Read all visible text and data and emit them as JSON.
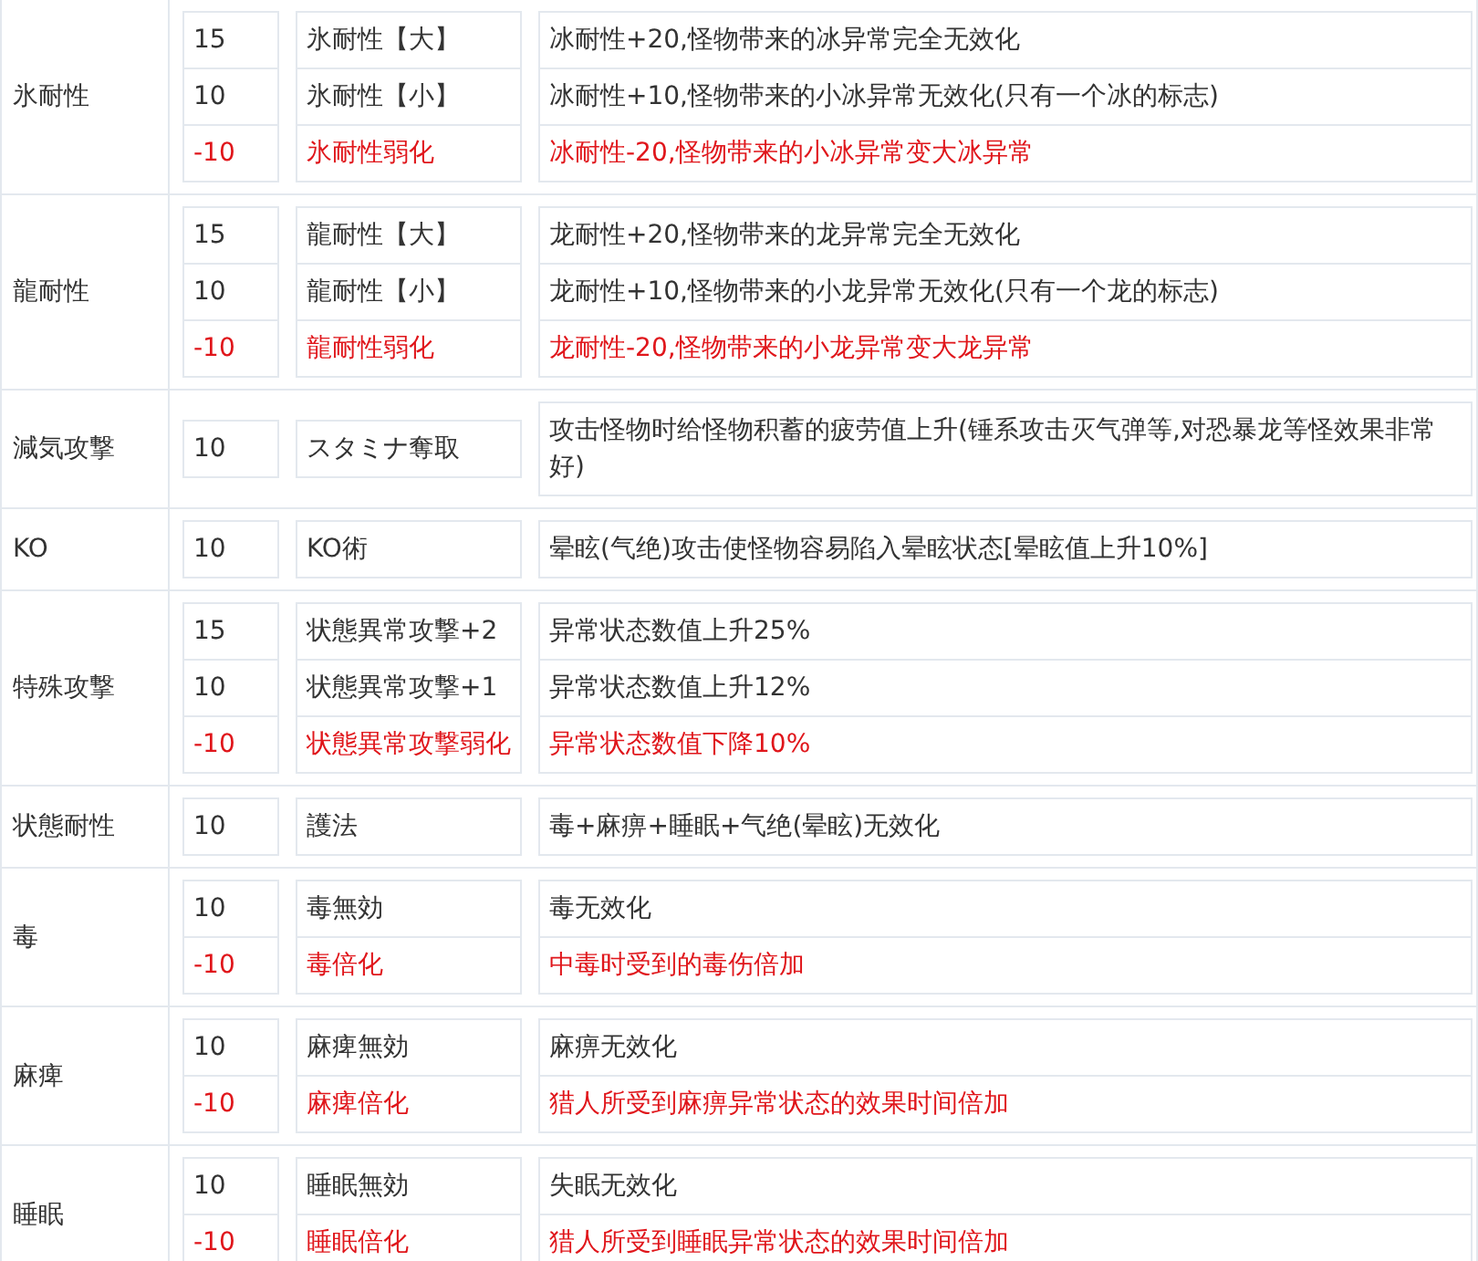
{
  "groups": [
    {
      "name": "氷耐性",
      "effects": [
        {
          "points": "15",
          "skill": "氷耐性【大】",
          "description": "冰耐性+20,怪物带来的冰异常完全无效化",
          "negative": false
        },
        {
          "points": "10",
          "skill": "氷耐性【小】",
          "description": "冰耐性+10,怪物带来的小冰异常无效化(只有一个冰的标志)",
          "negative": false
        },
        {
          "points": "-10",
          "skill": "氷耐性弱化",
          "description": "冰耐性-20,怪物带来的小冰异常变大冰异常",
          "negative": true
        }
      ]
    },
    {
      "name": "龍耐性",
      "effects": [
        {
          "points": "15",
          "skill": "龍耐性【大】",
          "description": "龙耐性+20,怪物带来的龙异常完全无效化",
          "negative": false
        },
        {
          "points": "10",
          "skill": "龍耐性【小】",
          "description": "龙耐性+10,怪物带来的小龙异常无效化(只有一个龙的标志)",
          "negative": false
        },
        {
          "points": "-10",
          "skill": "龍耐性弱化",
          "description": "龙耐性-20,怪物带来的小龙异常变大龙异常",
          "negative": true
        }
      ]
    },
    {
      "name": "減気攻撃",
      "effects": [
        {
          "points": "10",
          "skill": "スタミナ奪取",
          "description": "攻击怪物时给怪物积蓄的疲劳值上升(锤系攻击灭气弹等,对恐暴龙等怪效果非常好)",
          "negative": false
        }
      ]
    },
    {
      "name": "KO",
      "effects": [
        {
          "points": "10",
          "skill": "KO術",
          "description": "晕眩(气绝)攻击使怪物容易陷入晕眩状态[晕眩值上升10%]",
          "negative": false
        }
      ]
    },
    {
      "name": "特殊攻撃",
      "effects": [
        {
          "points": "15",
          "skill": "状態異常攻撃+2",
          "description": "异常状态数值上升25%",
          "negative": false
        },
        {
          "points": "10",
          "skill": "状態異常攻撃+1",
          "description": "异常状态数值上升12%",
          "negative": false
        },
        {
          "points": "-10",
          "skill": "状態異常攻撃弱化",
          "description": "异常状态数值下降10%",
          "negative": true
        }
      ]
    },
    {
      "name": "状態耐性",
      "effects": [
        {
          "points": "10",
          "skill": "護法",
          "description": "毒+麻痹+睡眠+气绝(晕眩)无效化",
          "negative": false
        }
      ]
    },
    {
      "name": "毒",
      "effects": [
        {
          "points": "10",
          "skill": "毒無効",
          "description": "毒无效化",
          "negative": false
        },
        {
          "points": "-10",
          "skill": "毒倍化",
          "description": "中毒时受到的毒伤倍加",
          "negative": true
        }
      ]
    },
    {
      "name": "麻痺",
      "effects": [
        {
          "points": "10",
          "skill": "麻痺無効",
          "description": "麻痹无效化",
          "negative": false
        },
        {
          "points": "-10",
          "skill": "麻痺倍化",
          "description": "猎人所受到麻痹异常状态的效果时间倍加",
          "negative": true
        }
      ]
    },
    {
      "name": "睡眠",
      "effects": [
        {
          "points": "10",
          "skill": "睡眠無効",
          "description": "失眠无效化",
          "negative": false
        },
        {
          "points": "-10",
          "skill": "睡眠倍化",
          "description": "猎人所受到睡眠异常状态的效果时间倍加",
          "negative": true
        }
      ]
    }
  ]
}
